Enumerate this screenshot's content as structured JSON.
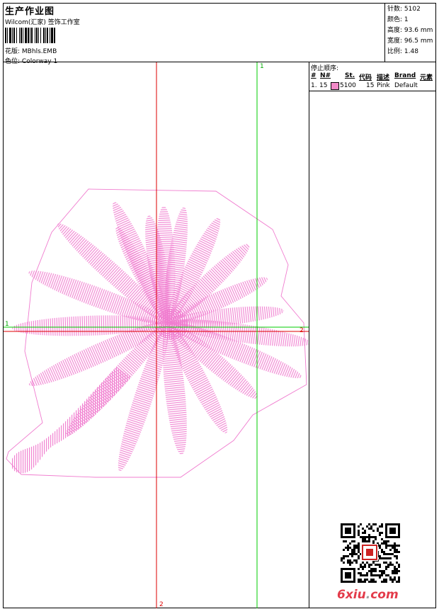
{
  "header": {
    "title": "生产作业图",
    "company": "Wilcom(汇家) 签饰工作室",
    "design_label": "花版:",
    "design_value": "MBhls.EMB",
    "colorway_label": "色位:",
    "colorway_value": "Colorway 1"
  },
  "stats": [
    {
      "label": "针数:",
      "value": "5102"
    },
    {
      "label": "颜色:",
      "value": "1"
    },
    {
      "label": "高度:",
      "value": "93.6 mm"
    },
    {
      "label": "宽度:",
      "value": "96.5 mm"
    },
    {
      "label": "比例:",
      "value": "1.48"
    }
  ],
  "stops": {
    "title": "停止顺序:",
    "columns": [
      "#",
      "N#",
      "St.",
      "代码",
      "描述",
      "Brand",
      "元素"
    ],
    "rows": [
      {
        "index": "1.",
        "needle": "15",
        "code_number": "5100",
        "stitches": "15",
        "description": "Pink",
        "brand": "Default",
        "swatch_color": "#f28ac8"
      }
    ]
  },
  "guides": {
    "h_start_label": "1",
    "h_end_label": "2",
    "v_top_label": "1",
    "v_bottom_label": "2"
  },
  "colors": {
    "thread": "#f07ccf",
    "red_guide": "#dd0000",
    "green_guide": "#00cc00"
  },
  "watermark": {
    "part1": "6xiu",
    "dot": ".",
    "part2": "com"
  },
  "qr_icon": "qr-code-icon"
}
